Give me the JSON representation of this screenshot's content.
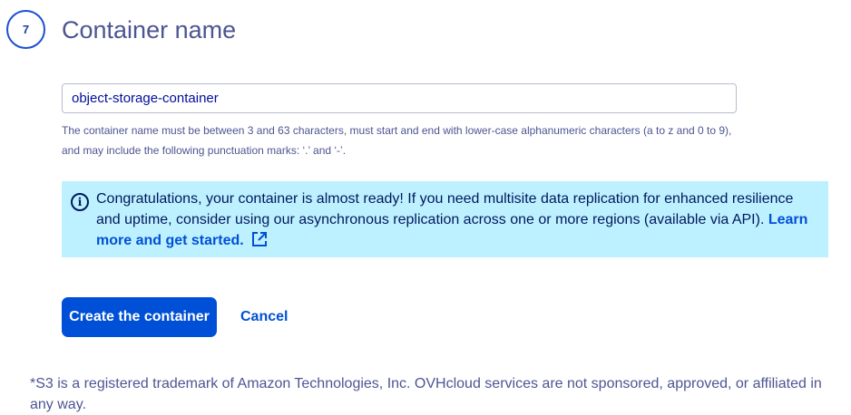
{
  "step": {
    "number": "7",
    "title": "Container name"
  },
  "name_field": {
    "value": "object-storage-container",
    "helper": "The container name must be between 3 and 63 characters, must start and end with lower-case alphanumeric characters (a to z and 0 to 9), and may include the following punctuation marks: ‘.’ and ‘-’."
  },
  "info": {
    "icon": "info-icon",
    "text": "Congratulations, your container is almost ready! If you need multisite data replication for enhanced resilience and uptime, consider using our asynchronous replication across one or more regions (available via API). ",
    "link_label": "Learn more and get started.",
    "link_icon": "external-link-icon"
  },
  "actions": {
    "create_label": "Create the container",
    "cancel_label": "Cancel"
  },
  "footnote": "*S3 is a registered trademark of Amazon Technologies, Inc. OVHcloud services are not sponsored, approved, or affiliated in any way.",
  "colors": {
    "primary": "#0050d7",
    "info_background": "#bef1ff",
    "text": "#4d5592"
  }
}
